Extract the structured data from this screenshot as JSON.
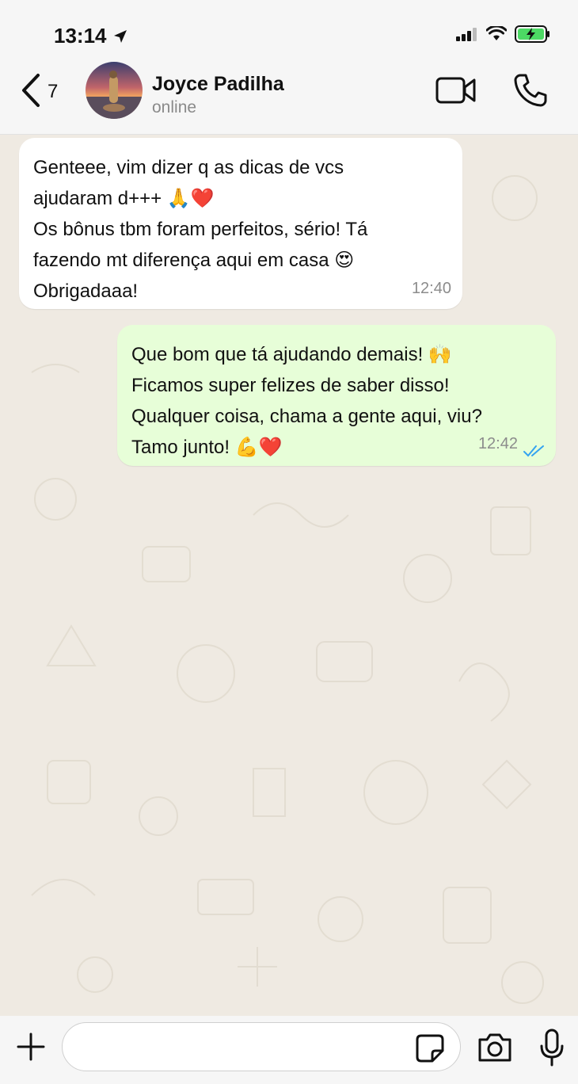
{
  "status_bar": {
    "time": "13:14",
    "icons": [
      "location-arrow-icon",
      "signal-icon",
      "wifi-icon",
      "battery-charging-icon"
    ]
  },
  "header": {
    "back_count": "7",
    "contact_name": "Joyce Padilha",
    "contact_status": "online",
    "icons": [
      "chevron-left-icon",
      "video-camera-icon",
      "phone-icon"
    ]
  },
  "messages": [
    {
      "direction": "incoming",
      "lines": [
        "Genteee, vim dizer q as dicas de vcs",
        "ajudaram d+++ 🙏❤️",
        "Os bônus tbm foram perfeitos, sério! Tá",
        "fazendo mt diferença aqui em casa 😍",
        "Obrigadaaa!"
      ],
      "time": "12:40"
    },
    {
      "direction": "outgoing",
      "lines": [
        "Que bom que tá ajudando demais! 🙌",
        "Ficamos super felizes de saber disso!",
        "Qualquer coisa, chama a gente aqui, viu?",
        "Tamo junto! 💪❤️"
      ],
      "time": "12:42",
      "status": "read"
    }
  ],
  "input_bar": {
    "placeholder": "",
    "icons": [
      "plus-icon",
      "sticker-icon",
      "camera-icon",
      "microphone-icon"
    ]
  },
  "colors": {
    "outgoing_bubble": "#e7fed8",
    "incoming_bubble": "#ffffff",
    "read_ticks": "#34a3f0",
    "wallpaper": "#efeae2",
    "battery_green": "#4cd964"
  }
}
